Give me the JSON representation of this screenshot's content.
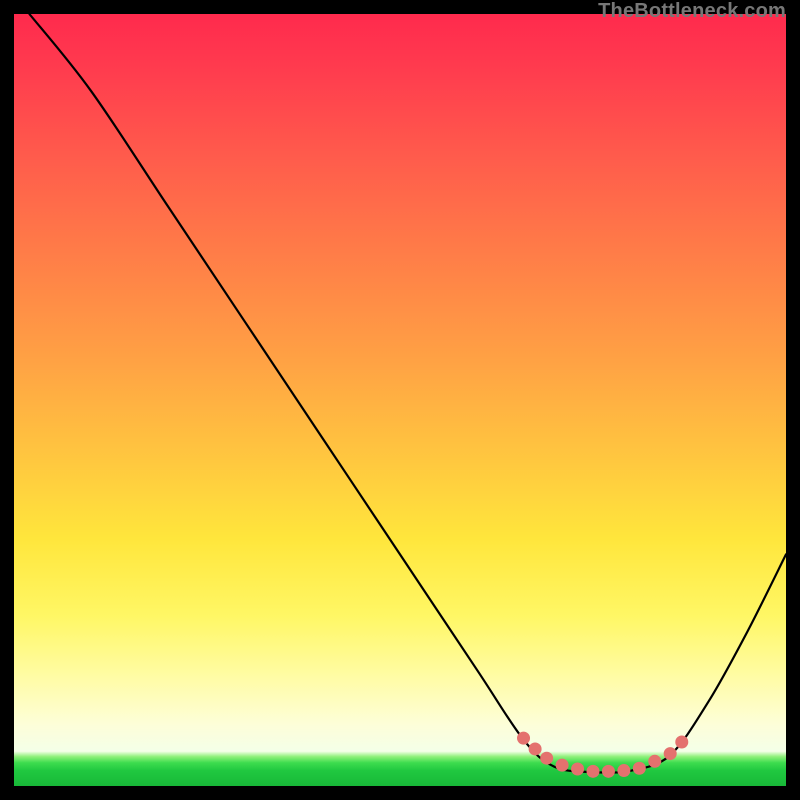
{
  "watermark": "TheBottleneck.com",
  "chart_data": {
    "type": "line",
    "title": "",
    "xlabel": "",
    "ylabel": "",
    "xlim": [
      0,
      100
    ],
    "ylim": [
      0,
      100
    ],
    "series": [
      {
        "name": "curve",
        "points": [
          {
            "x": 2,
            "y": 100
          },
          {
            "x": 10,
            "y": 90
          },
          {
            "x": 20,
            "y": 75
          },
          {
            "x": 30,
            "y": 60
          },
          {
            "x": 40,
            "y": 45
          },
          {
            "x": 50,
            "y": 30
          },
          {
            "x": 60,
            "y": 15
          },
          {
            "x": 66,
            "y": 6
          },
          {
            "x": 70,
            "y": 2.5
          },
          {
            "x": 75,
            "y": 1.8
          },
          {
            "x": 80,
            "y": 2
          },
          {
            "x": 85,
            "y": 4
          },
          {
            "x": 90,
            "y": 11
          },
          {
            "x": 95,
            "y": 20
          },
          {
            "x": 100,
            "y": 30
          }
        ]
      },
      {
        "name": "bottom-dots",
        "color": "#e4716e",
        "points": [
          {
            "x": 66,
            "y": 6.2
          },
          {
            "x": 67.5,
            "y": 4.8
          },
          {
            "x": 69,
            "y": 3.6
          },
          {
            "x": 71,
            "y": 2.7
          },
          {
            "x": 73,
            "y": 2.2
          },
          {
            "x": 75,
            "y": 1.9
          },
          {
            "x": 77,
            "y": 1.9
          },
          {
            "x": 79,
            "y": 2.0
          },
          {
            "x": 81,
            "y": 2.3
          },
          {
            "x": 83,
            "y": 3.2
          },
          {
            "x": 85,
            "y": 4.2
          },
          {
            "x": 86.5,
            "y": 5.7
          }
        ]
      }
    ],
    "gradient_stops": [
      {
        "pos": 0.0,
        "color": "#ff2a4d"
      },
      {
        "pos": 0.3,
        "color": "#ff7a48"
      },
      {
        "pos": 0.58,
        "color": "#ffc83f"
      },
      {
        "pos": 0.78,
        "color": "#fff765"
      },
      {
        "pos": 0.95,
        "color": "#f4ffe8"
      },
      {
        "pos": 0.97,
        "color": "#3ddc4e"
      },
      {
        "pos": 1.0,
        "color": "#18b838"
      }
    ]
  }
}
